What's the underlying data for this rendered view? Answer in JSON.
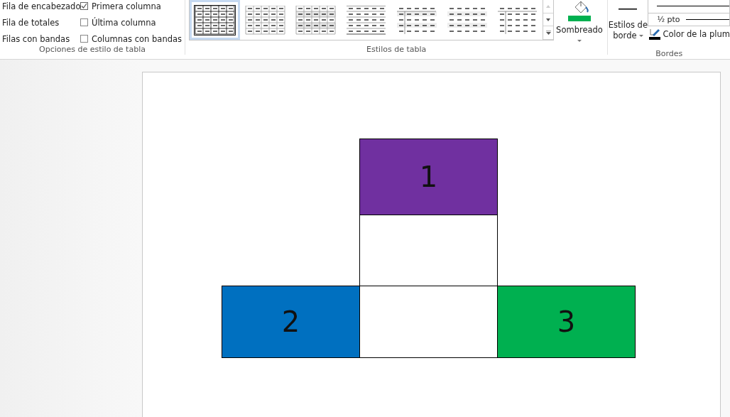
{
  "ribbon": {
    "style_options": {
      "label": "Opciones de estilo de tabla",
      "options": [
        {
          "label": "Fila de encabezado",
          "kind": "plain"
        },
        {
          "label": "Primera columna",
          "kind": "checkbox",
          "checked": true
        },
        {
          "label": "Fila de totales",
          "kind": "plain"
        },
        {
          "label": "Última columna",
          "kind": "checkbox",
          "checked": false
        },
        {
          "label": "Filas con bandas",
          "kind": "plain"
        },
        {
          "label": "Columnas con bandas",
          "kind": "checkbox",
          "checked": false
        }
      ]
    },
    "table_styles": {
      "label": "Estilos de tabla",
      "styles": [
        {
          "kind": "grid-dark",
          "selected": true
        },
        {
          "kind": "grid-light",
          "selected": false
        },
        {
          "kind": "grid-banded",
          "selected": false
        },
        {
          "kind": "lines",
          "selected": false
        },
        {
          "kind": "first-column-banded",
          "selected": false
        },
        {
          "kind": "banded",
          "selected": false
        },
        {
          "kind": "first-column",
          "selected": false
        }
      ]
    },
    "shading": {
      "label": "Sombreado",
      "color": "#00b050"
    },
    "borders": {
      "label": "Bordes",
      "border_styles": "Estilos de",
      "border_styles_2": "borde",
      "weight": "½ pto",
      "pen_color": "Color de la plum"
    }
  },
  "document": {
    "table": {
      "rows": [
        {
          "cells": [
            {
              "kind": "gap"
            },
            {
              "kind": "cell",
              "text": "1",
              "color": "#7030a0"
            },
            {
              "kind": "gap"
            }
          ]
        },
        {
          "cells": [
            {
              "kind": "gap"
            },
            {
              "kind": "cell",
              "text": "",
              "color": "#ffffff"
            },
            {
              "kind": "gap"
            }
          ]
        },
        {
          "cells": [
            {
              "kind": "cell",
              "text": "2",
              "color": "#0070c0"
            },
            {
              "kind": "cell",
              "text": "",
              "color": "#ffffff"
            },
            {
              "kind": "cell",
              "text": "3",
              "color": "#00b050"
            }
          ]
        }
      ]
    }
  }
}
